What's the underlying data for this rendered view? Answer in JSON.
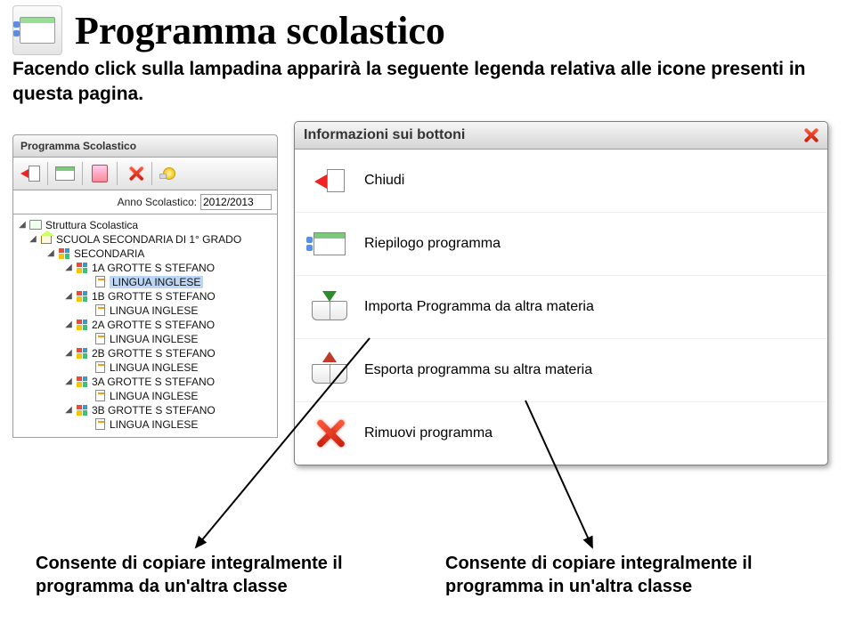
{
  "header": {
    "title": "Programma scolastico"
  },
  "intro_text": "Facendo click sulla lampadina apparirà la seguente legenda relativa alle icone presenti in questa pagina.",
  "left_panel": {
    "title": "Programma Scolastico",
    "year_label": "Anno Scolastico:",
    "year_value": "2012/2013",
    "toolbar": {
      "back": "back-icon",
      "summary": "summary-icon",
      "pdf": "pdf-icon",
      "delete": "delete-icon",
      "help": "lightbulb-icon"
    },
    "tree": {
      "root": "Struttura Scolastica",
      "school": "SCUOLA SECONDARIA DI 1° GRADO",
      "level": "SECONDARIA",
      "classes": [
        {
          "name": "1A GROTTE S STEFANO",
          "subjects": [
            {
              "name": "LINGUA INGLESE",
              "selected": true
            }
          ]
        },
        {
          "name": "1B GROTTE S STEFANO",
          "subjects": [
            {
              "name": "LINGUA INGLESE",
              "selected": false
            }
          ]
        },
        {
          "name": "2A GROTTE S STEFANO",
          "subjects": [
            {
              "name": "LINGUA INGLESE",
              "selected": false
            }
          ]
        },
        {
          "name": "2B GROTTE S STEFANO",
          "subjects": [
            {
              "name": "LINGUA INGLESE",
              "selected": false
            }
          ]
        },
        {
          "name": "3A GROTTE S STEFANO",
          "subjects": [
            {
              "name": "LINGUA INGLESE",
              "selected": false
            }
          ]
        },
        {
          "name": "3B GROTTE S STEFANO",
          "subjects": [
            {
              "name": "LINGUA INGLESE",
              "selected": false
            }
          ]
        }
      ]
    }
  },
  "info_panel": {
    "title": "Informazioni sui bottoni",
    "rows": [
      {
        "icon": "close-back",
        "label": "Chiudi"
      },
      {
        "icon": "summary",
        "label": "Riepilogo programma"
      },
      {
        "icon": "import",
        "label": "Importa Programma da altra materia"
      },
      {
        "icon": "export",
        "label": "Esporta programma su altra materia"
      },
      {
        "icon": "remove",
        "label": "Rimuovi programma"
      }
    ]
  },
  "annotations": {
    "a1": "Consente di copiare integralmente il programma da un'altra classe",
    "a2": "Consente di copiare integralmente il programma in un'altra classe"
  }
}
